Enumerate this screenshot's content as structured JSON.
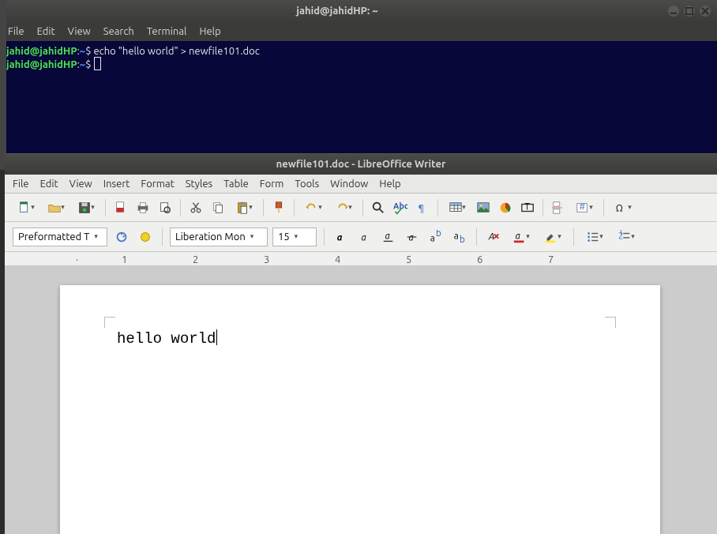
{
  "terminal": {
    "title": "jahid@jahidHP: ~",
    "menus": [
      "File",
      "Edit",
      "View",
      "Search",
      "Terminal",
      "Help"
    ],
    "prompt_user": "jahid@jahidHP",
    "prompt_sep": ":",
    "prompt_path": "~",
    "prompt_symbol": "$",
    "line1_cmd": "echo \"hello world\" > newfile101.doc"
  },
  "lo": {
    "title": "newfile101.doc - LibreOffice Writer",
    "menus": [
      "File",
      "Edit",
      "View",
      "Insert",
      "Format",
      "Styles",
      "Table",
      "Form",
      "Tools",
      "Window",
      "Help"
    ],
    "style_select": "Preformatted T",
    "font_select": "Liberation Mon",
    "size_select": "15",
    "document_text": "hello world"
  }
}
